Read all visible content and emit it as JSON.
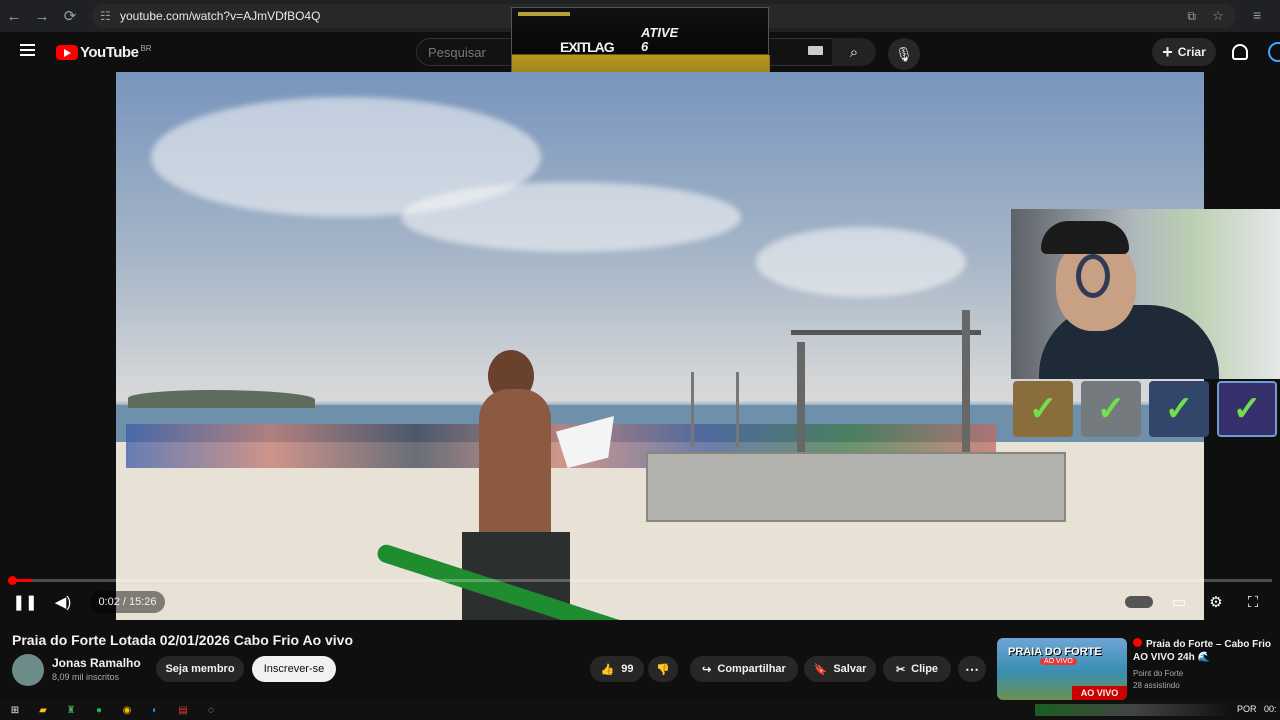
{
  "browser": {
    "url": "youtube.com/watch?v=AJmVDfBO4Q",
    "back": "←",
    "forward": "→",
    "reload": "⟳"
  },
  "youtube": {
    "logo": "YouTube",
    "country": "BR",
    "search_placeholder": "Pesquisar",
    "create": "Criar"
  },
  "overlay_ad": {
    "brand": "EXITLAG",
    "text": "ATIVE",
    "number": "6"
  },
  "player": {
    "time": "0:02 / 15:26",
    "progress": 0.002
  },
  "video": {
    "title": "Praia do Forte Lotada 02/01/2026 Cabo Frio Ao vivo"
  },
  "channel": {
    "name": "Jonas Ramalho",
    "subscribers": "8,09 mil inscritos",
    "member": "Seja membro",
    "subscribe": "Inscrever-se"
  },
  "actions": {
    "likes": "99",
    "share": "Compartilhar",
    "save": "Salvar",
    "clip": "Clipe"
  },
  "recommendation": {
    "thumb_title": "PRAIA DO FORTE",
    "thumb_sub": "AO VIVO",
    "thumb_badge": "AO VIVO",
    "title": "Praia do Forte – Cabo Frio AO VIVO 24h 🌊",
    "channel": "Point do Forte",
    "watching": "28 assistindo"
  },
  "taskbar": {
    "lang": "POR",
    "time": "00:"
  },
  "colors": {
    "youtube_red": "#ff0000",
    "green_check": "#72e04d"
  }
}
